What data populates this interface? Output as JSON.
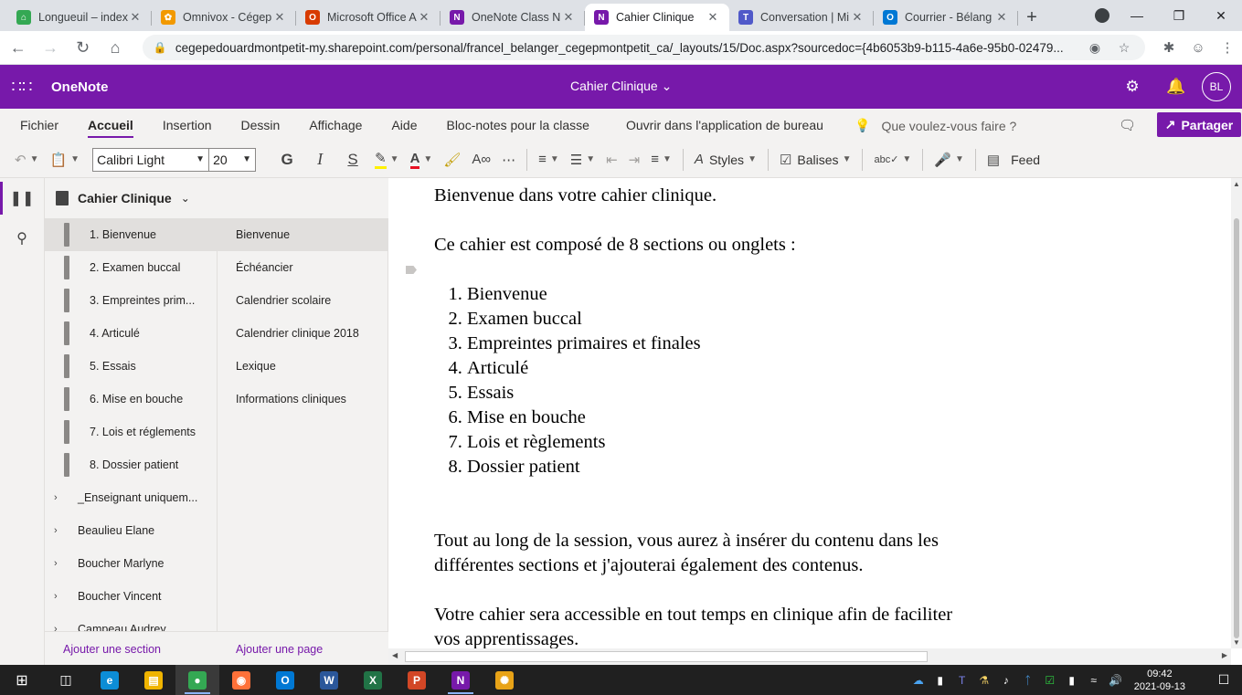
{
  "browser": {
    "tabs": [
      {
        "title": "Longueuil – index",
        "icon": "shield-icon",
        "color": "#34a853",
        "glyph": "⌂",
        "active": false
      },
      {
        "title": "Omnivox - Cégep",
        "icon": "flower-icon",
        "color": "#f29900",
        "glyph": "✿",
        "active": false
      },
      {
        "title": "Microsoft Office A",
        "icon": "office-icon",
        "color": "#d83b01",
        "glyph": "O",
        "active": false
      },
      {
        "title": "OneNote Class N",
        "icon": "onenote-icon",
        "color": "#7719aa",
        "glyph": "N",
        "active": false
      },
      {
        "title": "Cahier Clinique",
        "icon": "onenote-icon",
        "color": "#7719aa",
        "glyph": "N",
        "active": true
      },
      {
        "title": "Conversation | Mi",
        "icon": "teams-icon",
        "color": "#5059c9",
        "glyph": "T",
        "active": false
      },
      {
        "title": "Courrier - Bélang",
        "icon": "outlook-icon",
        "color": "#0078d4",
        "glyph": "O",
        "active": false
      }
    ],
    "url": "cegepedouardmontpetit-my.sharepoint.com/personal/francel_belanger_cegepmontpetit_ca/_layouts/15/Doc.aspx?sourcedoc={4b6053b9-b115-4a6e-95b0-02479..."
  },
  "app": {
    "name": "OneNote",
    "doc_title": "Cahier Clinique ⌄",
    "avatar_initials": "BL",
    "accent": "#7719aa"
  },
  "ribbon": {
    "tabs": [
      "Fichier",
      "Accueil",
      "Insertion",
      "Dessin",
      "Affichage",
      "Aide",
      "Bloc-notes pour la classe"
    ],
    "open_desktop": "Ouvrir dans l'application de bureau",
    "tell_me": "Que voulez-vous faire ?",
    "share": "Partager"
  },
  "toolbar": {
    "font": "Calibri Light",
    "size": "20",
    "bold": "G",
    "italic": "I",
    "strike": "S",
    "styles": "Styles",
    "tags": "Balises",
    "feed": "Feed"
  },
  "notebook": {
    "name": "Cahier Clinique",
    "sections": [
      "1. Bienvenue",
      "2. Examen buccal",
      "3. Empreintes prim...",
      "4. Articulé",
      "5. Essais",
      "6. Mise en bouche",
      "7. Lois et réglements",
      "8. Dossier patient"
    ],
    "groups": [
      "_Enseignant uniquem...",
      "Beaulieu Elane",
      "Boucher Marlyne",
      "Boucher Vincent",
      "Campeau Audrey"
    ],
    "pages": [
      "Bienvenue",
      "Échéancier",
      "Calendrier scolaire",
      "Calendrier clinique 2018",
      "Lexique",
      "Informations cliniques"
    ],
    "add_section": "Ajouter une section",
    "add_page": "Ajouter une page"
  },
  "content": {
    "welcome": "Bienvenue dans votre cahier clinique.",
    "intro": "Ce cahier est composé de 8 sections ou onglets :",
    "list": [
      "Bienvenue",
      "Examen buccal",
      "Empreintes primaires et finales",
      "Articulé",
      "Essais",
      "Mise en bouche",
      "Lois et règlements",
      "Dossier patient"
    ],
    "para1": "Tout au long de la session, vous aurez à insérer du contenu dans les différentes sections et j'ajouterai également des contenus.",
    "para2": "Votre cahier sera accessible en tout temps en clinique afin de faciliter vos apprentissages."
  },
  "taskbar": {
    "time": "09:42",
    "date": "2021-09-13",
    "apps": [
      {
        "name": "edge",
        "color": "#0c8dd6",
        "glyph": "e"
      },
      {
        "name": "explorer",
        "color": "#f0b400",
        "glyph": "▤"
      },
      {
        "name": "chrome",
        "color": "#34a853",
        "glyph": "●"
      },
      {
        "name": "firefox",
        "color": "#ff7139",
        "glyph": "◉"
      },
      {
        "name": "outlook",
        "color": "#0078d4",
        "glyph": "O"
      },
      {
        "name": "word",
        "color": "#2b579a",
        "glyph": "W"
      },
      {
        "name": "excel",
        "color": "#217346",
        "glyph": "X"
      },
      {
        "name": "powerpoint",
        "color": "#d24726",
        "glyph": "P"
      },
      {
        "name": "onenote",
        "color": "#7719aa",
        "glyph": "N"
      },
      {
        "name": "sunflower",
        "color": "#e8a317",
        "glyph": "✺"
      }
    ]
  }
}
